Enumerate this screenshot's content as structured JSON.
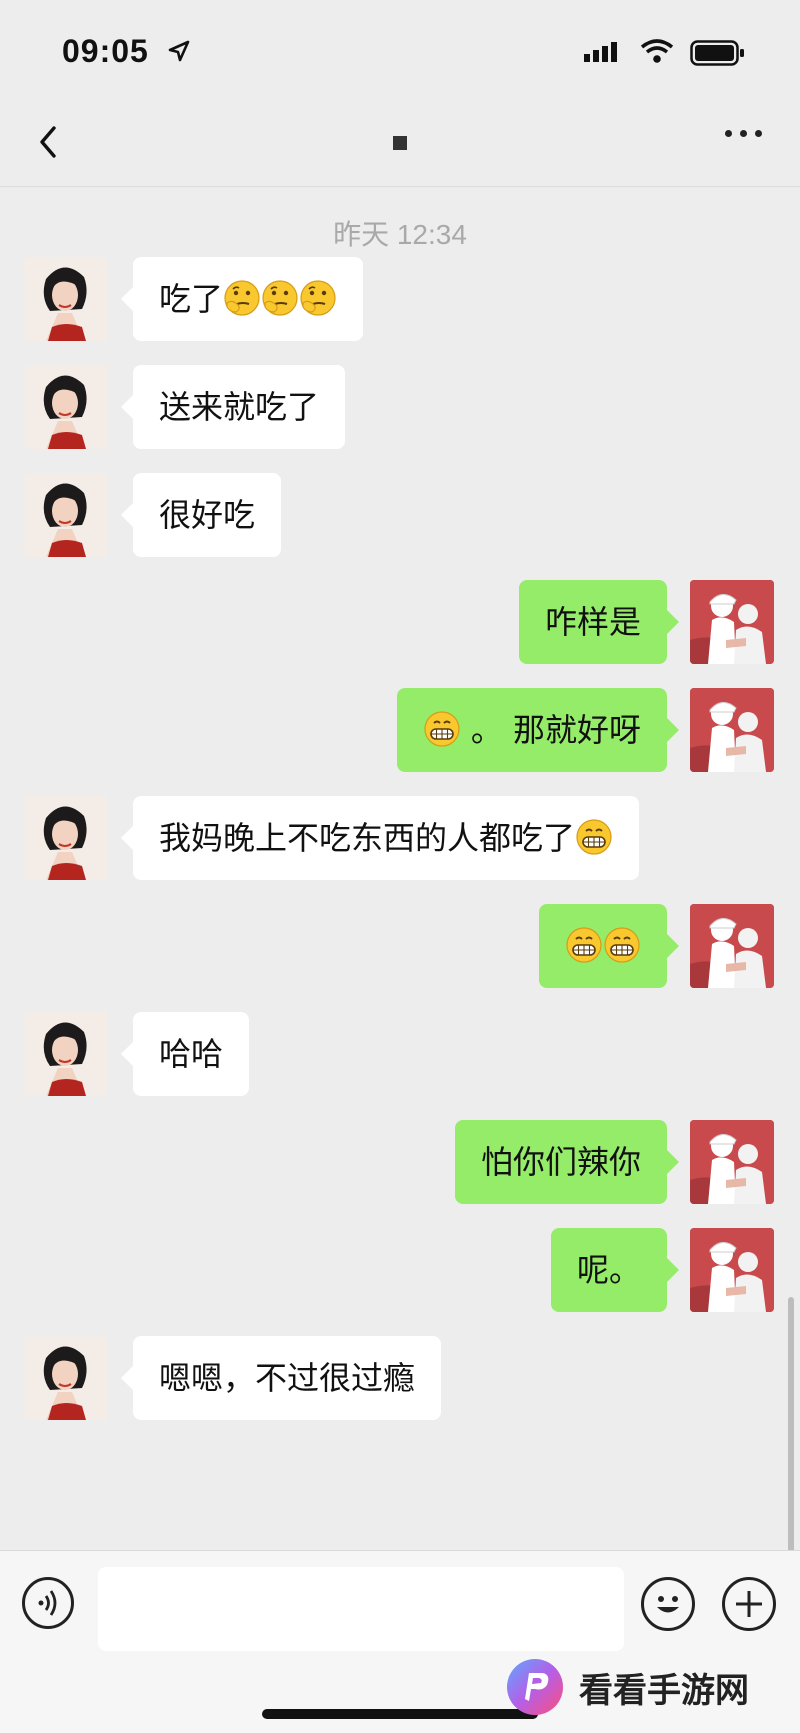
{
  "status_bar": {
    "time": "09:05"
  },
  "nav": {
    "title": "▪"
  },
  "chat": {
    "timestamp": "昨天 12:34",
    "messages": [
      {
        "side": "in",
        "text": "吃了",
        "emojis": [
          "thinking",
          "thinking",
          "thinking"
        ]
      },
      {
        "side": "in",
        "text": "送来就吃了",
        "emojis": []
      },
      {
        "side": "in",
        "text": "很好吃",
        "emojis": []
      },
      {
        "side": "out",
        "text": "咋样是",
        "emojis": []
      },
      {
        "side": "out",
        "text": "。 那就好呀",
        "emojis_before": [
          "grin"
        ]
      },
      {
        "side": "in",
        "text": "我妈晚上不吃东西的人都吃了",
        "emojis": [
          "grin"
        ]
      },
      {
        "side": "out",
        "text": "",
        "emojis": [
          "grin",
          "grin"
        ]
      },
      {
        "side": "in",
        "text": "哈哈",
        "emojis": []
      },
      {
        "side": "out",
        "text": "怕你们辣你",
        "emojis": []
      },
      {
        "side": "out",
        "text": "呢。",
        "emojis": []
      },
      {
        "side": "in",
        "text": "嗯嗯，不过很过瘾",
        "emojis": []
      }
    ]
  },
  "input_bar": {
    "placeholder": ""
  },
  "watermark": {
    "text": "看看手游网"
  },
  "colors": {
    "outgoing_bubble": "#95ec69",
    "incoming_bubble": "#ffffff",
    "background": "#ededed"
  }
}
